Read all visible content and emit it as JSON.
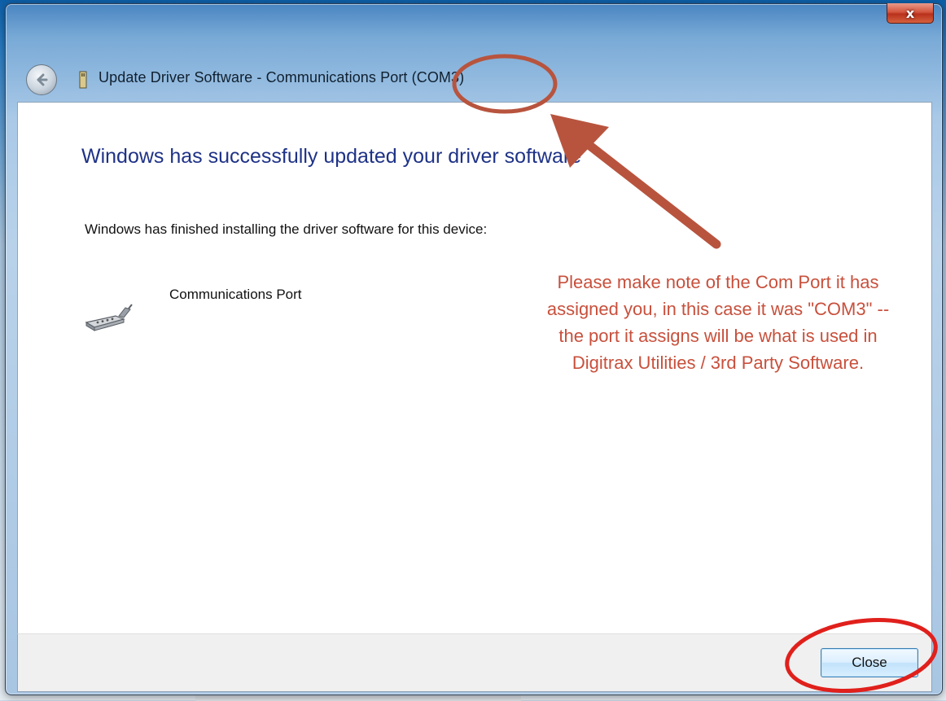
{
  "window": {
    "title": "Update Driver Software - Communications Port (COM3)",
    "close_glyph": "x"
  },
  "content": {
    "heading": "Windows has successfully updated your driver software",
    "subtext": "Windows has finished installing the driver software for this device:",
    "device_name": "Communications Port",
    "device_icon": "serial-port-icon"
  },
  "annotation": {
    "note": "Please make note of the Com Port it has assigned you, in this case it was \"COM3\" -- the port it assigns will be what is used in Digitrax Utilities / 3rd Party Software.",
    "color": "#c8503c"
  },
  "footer": {
    "close_label": "Close"
  },
  "colors": {
    "heading": "#1e3287",
    "annotation_arrow": "#b8543e",
    "highlight_circle_red": "#e0201c"
  }
}
